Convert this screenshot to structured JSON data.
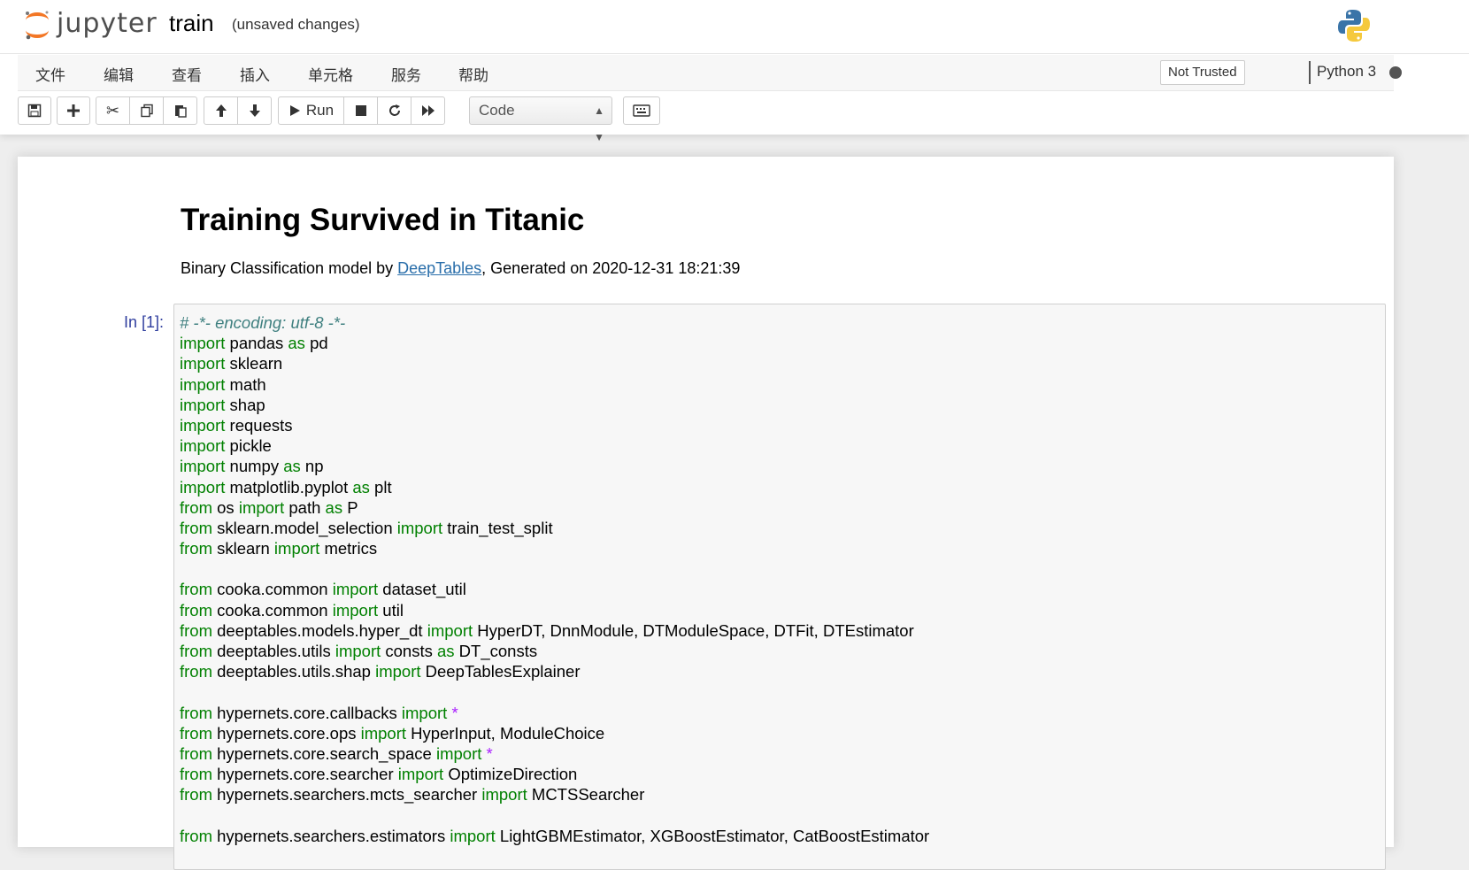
{
  "app": {
    "logo_text": "jupyter",
    "notebook_name": "train",
    "save_status": "(unsaved changes)"
  },
  "menu": {
    "items": [
      "文件",
      "编辑",
      "查看",
      "插入",
      "单元格",
      "服务",
      "帮助"
    ],
    "trusted_label": "Not Trusted",
    "kernel_name": "Python 3"
  },
  "toolbar": {
    "run_label": "Run",
    "cell_type": "Code",
    "icons": [
      "save-icon",
      "plus-icon",
      "cut-icon",
      "copy-icon",
      "paste-icon",
      "arrow-up-icon",
      "arrow-down-icon",
      "play-icon",
      "stop-icon",
      "restart-icon",
      "fast-forward-icon",
      "keyboard-icon"
    ]
  },
  "notebook": {
    "title": "Training Survived in Titanic",
    "subtitle_prefix": "Binary Classification model by ",
    "subtitle_link": "DeepTables",
    "subtitle_suffix": ", Generated on 2020-12-31 18:21:39",
    "prompt": "In [1]:",
    "code_lines": [
      [
        {
          "t": "# -*- encoding: utf-8 -*-",
          "c": "comment"
        }
      ],
      [
        {
          "t": "import",
          "c": "kw"
        },
        {
          "t": " pandas "
        },
        {
          "t": "as",
          "c": "kw"
        },
        {
          "t": " pd"
        }
      ],
      [
        {
          "t": "import",
          "c": "kw"
        },
        {
          "t": " sklearn"
        }
      ],
      [
        {
          "t": "import",
          "c": "kw"
        },
        {
          "t": " math"
        }
      ],
      [
        {
          "t": "import",
          "c": "kw"
        },
        {
          "t": " shap"
        }
      ],
      [
        {
          "t": "import",
          "c": "kw"
        },
        {
          "t": " requests"
        }
      ],
      [
        {
          "t": "import",
          "c": "kw"
        },
        {
          "t": " pickle"
        }
      ],
      [
        {
          "t": "import",
          "c": "kw"
        },
        {
          "t": " numpy "
        },
        {
          "t": "as",
          "c": "kw"
        },
        {
          "t": " np"
        }
      ],
      [
        {
          "t": "import",
          "c": "kw"
        },
        {
          "t": " matplotlib.pyplot "
        },
        {
          "t": "as",
          "c": "kw"
        },
        {
          "t": " plt"
        }
      ],
      [
        {
          "t": "from",
          "c": "kw"
        },
        {
          "t": " os "
        },
        {
          "t": "import",
          "c": "kw"
        },
        {
          "t": " path "
        },
        {
          "t": "as",
          "c": "kw"
        },
        {
          "t": " P"
        }
      ],
      [
        {
          "t": "from",
          "c": "kw"
        },
        {
          "t": " sklearn.model_selection "
        },
        {
          "t": "import",
          "c": "kw"
        },
        {
          "t": " train_test_split"
        }
      ],
      [
        {
          "t": "from",
          "c": "kw"
        },
        {
          "t": " sklearn "
        },
        {
          "t": "import",
          "c": "kw"
        },
        {
          "t": " metrics"
        }
      ],
      [],
      [
        {
          "t": "from",
          "c": "kw"
        },
        {
          "t": " cooka.common "
        },
        {
          "t": "import",
          "c": "kw"
        },
        {
          "t": " dataset_util"
        }
      ],
      [
        {
          "t": "from",
          "c": "kw"
        },
        {
          "t": " cooka.common "
        },
        {
          "t": "import",
          "c": "kw"
        },
        {
          "t": " util"
        }
      ],
      [
        {
          "t": "from",
          "c": "kw"
        },
        {
          "t": " deeptables.models.hyper_dt "
        },
        {
          "t": "import",
          "c": "kw"
        },
        {
          "t": " HyperDT, DnnModule, DTModuleSpace, DTFit, DTEstimator"
        }
      ],
      [
        {
          "t": "from",
          "c": "kw"
        },
        {
          "t": " deeptables.utils "
        },
        {
          "t": "import",
          "c": "kw"
        },
        {
          "t": " consts "
        },
        {
          "t": "as",
          "c": "kw"
        },
        {
          "t": " DT_consts"
        }
      ],
      [
        {
          "t": "from",
          "c": "kw"
        },
        {
          "t": " deeptables.utils.shap "
        },
        {
          "t": "import",
          "c": "kw"
        },
        {
          "t": " DeepTablesExplainer"
        }
      ],
      [],
      [
        {
          "t": "from",
          "c": "kw"
        },
        {
          "t": " hypernets.core.callbacks "
        },
        {
          "t": "import",
          "c": "kw"
        },
        {
          "t": " "
        },
        {
          "t": "*",
          "c": "star"
        }
      ],
      [
        {
          "t": "from",
          "c": "kw"
        },
        {
          "t": " hypernets.core.ops "
        },
        {
          "t": "import",
          "c": "kw"
        },
        {
          "t": " HyperInput, ModuleChoice"
        }
      ],
      [
        {
          "t": "from",
          "c": "kw"
        },
        {
          "t": " hypernets.core.search_space "
        },
        {
          "t": "import",
          "c": "kw"
        },
        {
          "t": " "
        },
        {
          "t": "*",
          "c": "star"
        }
      ],
      [
        {
          "t": "from",
          "c": "kw"
        },
        {
          "t": " hypernets.core.searcher "
        },
        {
          "t": "import",
          "c": "kw"
        },
        {
          "t": " OptimizeDirection"
        }
      ],
      [
        {
          "t": "from",
          "c": "kw"
        },
        {
          "t": " hypernets.searchers.mcts_searcher "
        },
        {
          "t": "import",
          "c": "kw"
        },
        {
          "t": " MCTSSearcher"
        }
      ],
      [],
      [
        {
          "t": "from",
          "c": "kw"
        },
        {
          "t": " hypernets.searchers.estimators "
        },
        {
          "t": "import",
          "c": "kw"
        },
        {
          "t": " LightGBMEstimator, XGBoostEstimator, CatBoostEstimator"
        }
      ]
    ]
  },
  "colors": {
    "keyword": "#008000",
    "comment": "#408080",
    "star": "#aa22ff",
    "link": "#296eaa",
    "prompt": "#303f9f"
  }
}
